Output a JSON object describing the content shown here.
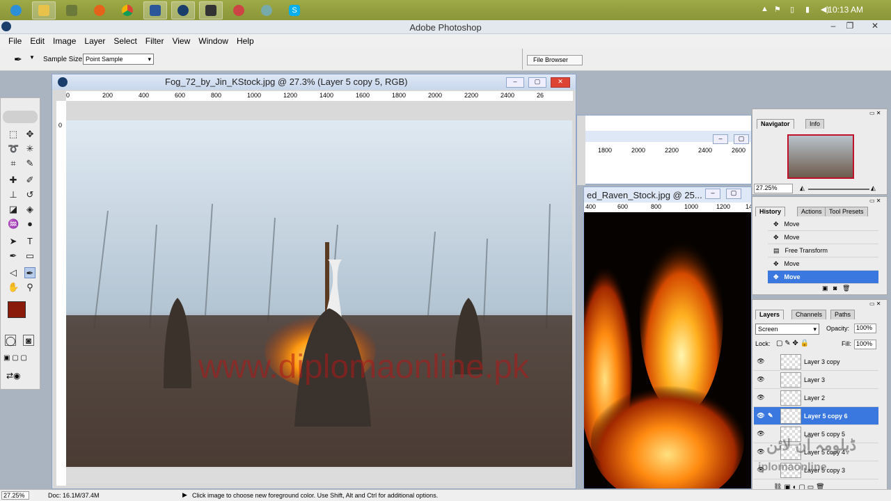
{
  "taskbar": {
    "clock": "10:13 AM"
  },
  "app": {
    "title": "Adobe Photoshop"
  },
  "menu": [
    "File",
    "Edit",
    "Image",
    "Layer",
    "Select",
    "Filter",
    "View",
    "Window",
    "Help"
  ],
  "options": {
    "sample_label": "Sample Size:",
    "sample_value": "Point Sample",
    "file_browser": "File Browser"
  },
  "doc1": {
    "title": "Fog_72_by_Jin_KStock.jpg @ 27.3% (Layer 5 copy 5, RGB)",
    "ruler_h": [
      "0",
      "200",
      "400",
      "600",
      "800",
      "1000",
      "1200",
      "1400",
      "1600",
      "1800",
      "2000",
      "2200",
      "2400",
      "26"
    ],
    "ruler_v": [
      "0"
    ],
    "watermark": "www.diplomaonline.pk"
  },
  "doc2": {
    "ruler_h": [
      "1800",
      "2000",
      "2200",
      "2400",
      "2600"
    ]
  },
  "doc3": {
    "title": "ed_Raven_Stock.jpg @ 25...",
    "ruler_h": [
      "400",
      "600",
      "800",
      "1000",
      "1200",
      "14"
    ]
  },
  "navigator": {
    "tabs": [
      "Navigator",
      "Info"
    ],
    "zoom": "27.25%"
  },
  "history": {
    "tabs": [
      "History",
      "Actions",
      "Tool Presets"
    ],
    "items": [
      {
        "label": "Move"
      },
      {
        "label": "Move"
      },
      {
        "label": "Free Transform"
      },
      {
        "label": "Move"
      },
      {
        "label": "Move",
        "selected": true
      }
    ]
  },
  "layers": {
    "tabs": [
      "Layers",
      "Channels",
      "Paths"
    ],
    "blend_mode": "Screen",
    "opacity_label": "Opacity:",
    "opacity": "100%",
    "lock_label": "Lock:",
    "fill_label": "Fill:",
    "fill": "100%",
    "items": [
      {
        "label": "Layer 3 copy"
      },
      {
        "label": "Layer 3"
      },
      {
        "label": "Layer 2"
      },
      {
        "label": "Layer 5 copy 6",
        "selected": true
      },
      {
        "label": "Layer 5 copy 5"
      },
      {
        "label": "Layer 5 copy 4"
      },
      {
        "label": "Layer 5 copy 3"
      }
    ],
    "watermark_urdu": "ڈپلومہ آن لائن",
    "watermark_latin": "iplomaonline"
  },
  "status": {
    "zoom": "27.25%",
    "doc": "Doc: 16.1M/37.4M",
    "hint": "Click image to choose new foreground color.  Use Shift, Alt and Ctrl for additional options."
  },
  "colors": {
    "foreground": "#8a1a0a",
    "background": "#ffffff",
    "accent": "#3a78e0"
  }
}
